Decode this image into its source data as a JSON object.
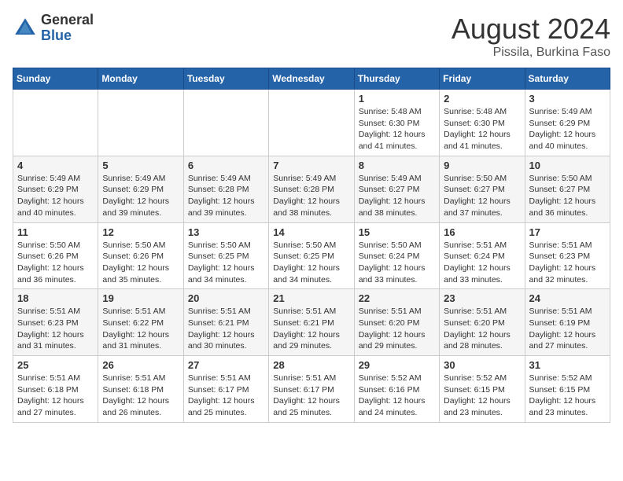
{
  "header": {
    "logo_general": "General",
    "logo_blue": "Blue",
    "month_year": "August 2024",
    "location": "Pissila, Burkina Faso"
  },
  "days_of_week": [
    "Sunday",
    "Monday",
    "Tuesday",
    "Wednesday",
    "Thursday",
    "Friday",
    "Saturday"
  ],
  "weeks": [
    {
      "row_index": 0,
      "days": [
        {
          "num": "",
          "info": ""
        },
        {
          "num": "",
          "info": ""
        },
        {
          "num": "",
          "info": ""
        },
        {
          "num": "",
          "info": ""
        },
        {
          "num": "1",
          "info": "Sunrise: 5:48 AM\nSunset: 6:30 PM\nDaylight: 12 hours\nand 41 minutes."
        },
        {
          "num": "2",
          "info": "Sunrise: 5:48 AM\nSunset: 6:30 PM\nDaylight: 12 hours\nand 41 minutes."
        },
        {
          "num": "3",
          "info": "Sunrise: 5:49 AM\nSunset: 6:29 PM\nDaylight: 12 hours\nand 40 minutes."
        }
      ]
    },
    {
      "row_index": 1,
      "days": [
        {
          "num": "4",
          "info": "Sunrise: 5:49 AM\nSunset: 6:29 PM\nDaylight: 12 hours\nand 40 minutes."
        },
        {
          "num": "5",
          "info": "Sunrise: 5:49 AM\nSunset: 6:29 PM\nDaylight: 12 hours\nand 39 minutes."
        },
        {
          "num": "6",
          "info": "Sunrise: 5:49 AM\nSunset: 6:28 PM\nDaylight: 12 hours\nand 39 minutes."
        },
        {
          "num": "7",
          "info": "Sunrise: 5:49 AM\nSunset: 6:28 PM\nDaylight: 12 hours\nand 38 minutes."
        },
        {
          "num": "8",
          "info": "Sunrise: 5:49 AM\nSunset: 6:27 PM\nDaylight: 12 hours\nand 38 minutes."
        },
        {
          "num": "9",
          "info": "Sunrise: 5:50 AM\nSunset: 6:27 PM\nDaylight: 12 hours\nand 37 minutes."
        },
        {
          "num": "10",
          "info": "Sunrise: 5:50 AM\nSunset: 6:27 PM\nDaylight: 12 hours\nand 36 minutes."
        }
      ]
    },
    {
      "row_index": 2,
      "days": [
        {
          "num": "11",
          "info": "Sunrise: 5:50 AM\nSunset: 6:26 PM\nDaylight: 12 hours\nand 36 minutes."
        },
        {
          "num": "12",
          "info": "Sunrise: 5:50 AM\nSunset: 6:26 PM\nDaylight: 12 hours\nand 35 minutes."
        },
        {
          "num": "13",
          "info": "Sunrise: 5:50 AM\nSunset: 6:25 PM\nDaylight: 12 hours\nand 34 minutes."
        },
        {
          "num": "14",
          "info": "Sunrise: 5:50 AM\nSunset: 6:25 PM\nDaylight: 12 hours\nand 34 minutes."
        },
        {
          "num": "15",
          "info": "Sunrise: 5:50 AM\nSunset: 6:24 PM\nDaylight: 12 hours\nand 33 minutes."
        },
        {
          "num": "16",
          "info": "Sunrise: 5:51 AM\nSunset: 6:24 PM\nDaylight: 12 hours\nand 33 minutes."
        },
        {
          "num": "17",
          "info": "Sunrise: 5:51 AM\nSunset: 6:23 PM\nDaylight: 12 hours\nand 32 minutes."
        }
      ]
    },
    {
      "row_index": 3,
      "days": [
        {
          "num": "18",
          "info": "Sunrise: 5:51 AM\nSunset: 6:23 PM\nDaylight: 12 hours\nand 31 minutes."
        },
        {
          "num": "19",
          "info": "Sunrise: 5:51 AM\nSunset: 6:22 PM\nDaylight: 12 hours\nand 31 minutes."
        },
        {
          "num": "20",
          "info": "Sunrise: 5:51 AM\nSunset: 6:21 PM\nDaylight: 12 hours\nand 30 minutes."
        },
        {
          "num": "21",
          "info": "Sunrise: 5:51 AM\nSunset: 6:21 PM\nDaylight: 12 hours\nand 29 minutes."
        },
        {
          "num": "22",
          "info": "Sunrise: 5:51 AM\nSunset: 6:20 PM\nDaylight: 12 hours\nand 29 minutes."
        },
        {
          "num": "23",
          "info": "Sunrise: 5:51 AM\nSunset: 6:20 PM\nDaylight: 12 hours\nand 28 minutes."
        },
        {
          "num": "24",
          "info": "Sunrise: 5:51 AM\nSunset: 6:19 PM\nDaylight: 12 hours\nand 27 minutes."
        }
      ]
    },
    {
      "row_index": 4,
      "days": [
        {
          "num": "25",
          "info": "Sunrise: 5:51 AM\nSunset: 6:18 PM\nDaylight: 12 hours\nand 27 minutes."
        },
        {
          "num": "26",
          "info": "Sunrise: 5:51 AM\nSunset: 6:18 PM\nDaylight: 12 hours\nand 26 minutes."
        },
        {
          "num": "27",
          "info": "Sunrise: 5:51 AM\nSunset: 6:17 PM\nDaylight: 12 hours\nand 25 minutes."
        },
        {
          "num": "28",
          "info": "Sunrise: 5:51 AM\nSunset: 6:17 PM\nDaylight: 12 hours\nand 25 minutes."
        },
        {
          "num": "29",
          "info": "Sunrise: 5:52 AM\nSunset: 6:16 PM\nDaylight: 12 hours\nand 24 minutes."
        },
        {
          "num": "30",
          "info": "Sunrise: 5:52 AM\nSunset: 6:15 PM\nDaylight: 12 hours\nand 23 minutes."
        },
        {
          "num": "31",
          "info": "Sunrise: 5:52 AM\nSunset: 6:15 PM\nDaylight: 12 hours\nand 23 minutes."
        }
      ]
    }
  ]
}
